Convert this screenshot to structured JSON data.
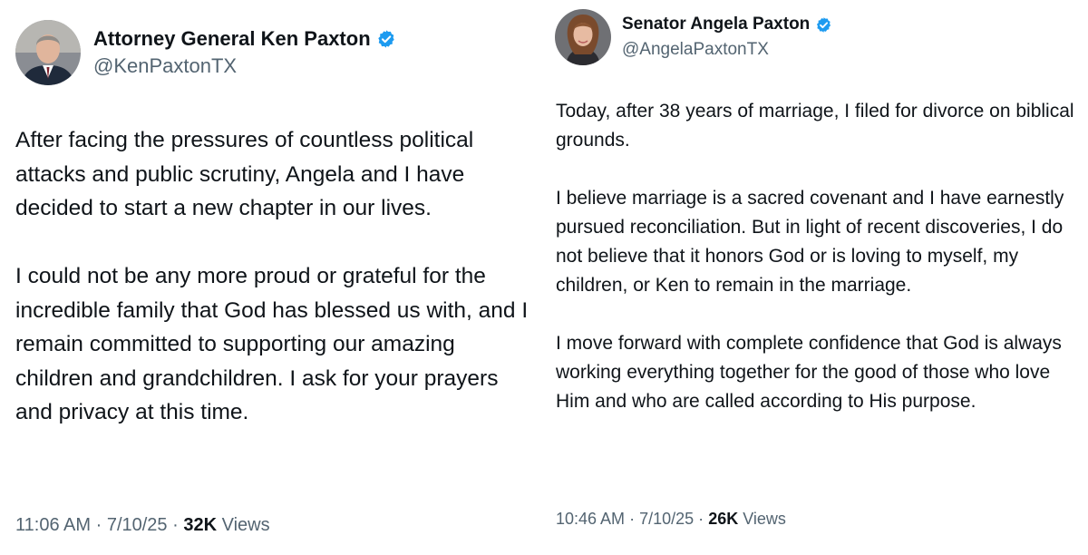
{
  "tweets": {
    "left": {
      "display_name": "Attorney General Ken Paxton",
      "handle": "@KenPaxtonTX",
      "verified_icon": "verified-badge-icon",
      "text": "After facing the pressures of countless political attacks and public scrutiny, Angela and I have decided to start a new chapter in our lives.\n\nI could not be any more proud or grateful for the incredible family that God has blessed us with, and I remain committed to supporting our amazing children and grandchildren. I ask for your prayers and privacy at this time.",
      "time": "11:06 AM",
      "date": "7/10/25",
      "separator": "·",
      "views_count": "32K",
      "views_label": "Views"
    },
    "right": {
      "display_name": "Senator Angela Paxton",
      "handle": "@AngelaPaxtonTX",
      "verified_icon": "verified-badge-icon",
      "text": "Today, after 38 years of marriage, I filed for divorce on biblical grounds.\n\nI believe marriage is a sacred covenant and I have earnestly pursued reconciliation. But in light of recent discoveries, I do not believe that it honors God or is loving to myself, my children, or Ken to remain in the marriage.\n\nI move forward with complete confidence that God is always working everything together for the good of those who love Him and who are called according to His purpose.",
      "time": "10:46 AM",
      "date": "7/10/25",
      "separator": "·",
      "views_count": "26K",
      "views_label": "Views"
    }
  },
  "colors": {
    "verified_blue": "#1d9bf0",
    "secondary_text": "#536471",
    "primary_text": "#0f1419"
  }
}
